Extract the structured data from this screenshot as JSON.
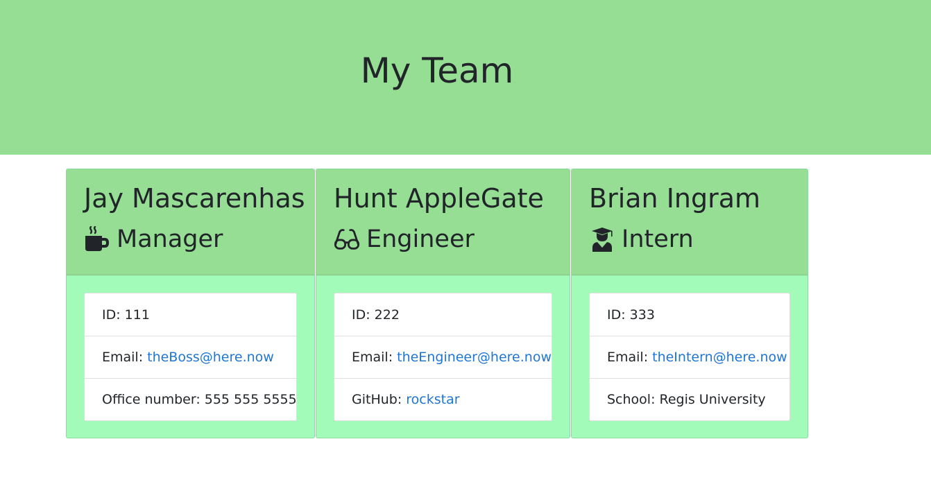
{
  "header": {
    "title": "My Team"
  },
  "colors": {
    "header_bg": "#96de94",
    "card_header_bg": "#96de94",
    "card_body_bg": "#a3fbb9",
    "link": "#1f75d6"
  },
  "team": [
    {
      "name": "Jay Mascarenhas",
      "role": "Manager",
      "role_icon": "coffee-mug-icon",
      "id_label": "ID:",
      "id": "111",
      "email_label": "Email:",
      "email": "theBoss@here.now",
      "extra_label": "Office number:",
      "extra_value": "555 555 5555"
    },
    {
      "name": "Hunt AppleGate",
      "role": "Engineer",
      "role_icon": "glasses-icon",
      "id_label": "ID:",
      "id": "222",
      "email_label": "Email:",
      "email": "theEngineer@here.now",
      "extra_label": "GitHub:",
      "extra_value": "rockstar"
    },
    {
      "name": "Brian Ingram",
      "role": "Intern",
      "role_icon": "graduate-icon",
      "id_label": "ID:",
      "id": "333",
      "email_label": "Email:",
      "email": "theIntern@here.now",
      "extra_label": "School:",
      "extra_value": "Regis University"
    }
  ]
}
